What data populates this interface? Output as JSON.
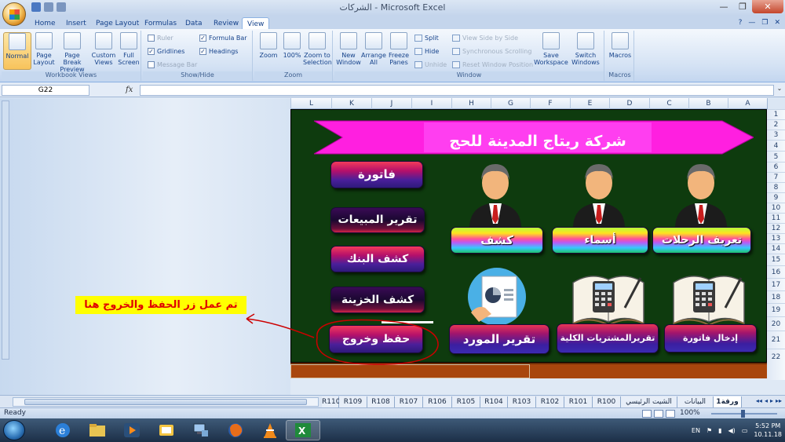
{
  "window": {
    "title": "الشركات - Microsoft Excel",
    "buttons": [
      "—",
      "❐",
      "✕"
    ]
  },
  "ribbon_tabs": [
    "Home",
    "Insert",
    "Page Layout",
    "Formulas",
    "Data",
    "Review",
    "View"
  ],
  "active_tab": "View",
  "ribbon": {
    "workbook_views": {
      "label": "Workbook Views",
      "buttons": [
        "Normal",
        "Page Layout",
        "Page Break Preview",
        "Custom Views",
        "Full Screen"
      ]
    },
    "show_hide": {
      "label": "Show/Hide",
      "ruler": "Ruler",
      "gridlines": "Gridlines",
      "message_bar": "Message Bar",
      "formula_bar": "Formula Bar",
      "headings": "Headings"
    },
    "zoom": {
      "label": "Zoom",
      "buttons": [
        "Zoom",
        "100%",
        "Zoom to Selection"
      ]
    },
    "window": {
      "label": "Window",
      "buttons": [
        "New Window",
        "Arrange All",
        "Freeze Panes"
      ],
      "split": "Split",
      "hide": "Hide",
      "unhide": "Unhide",
      "side_by_side": "View Side by Side",
      "sync_scroll": "Synchronous Scrolling",
      "reset_pos": "Reset Window Position",
      "save_workspace": "Save Workspace",
      "switch_windows": "Switch Windows"
    },
    "macros": {
      "label": "Macros",
      "button": "Macros"
    }
  },
  "formula_bar": {
    "name_box": "G22",
    "fx": "fx"
  },
  "columns": [
    "L",
    "K",
    "J",
    "I",
    "H",
    "G",
    "F",
    "E",
    "D",
    "C",
    "B",
    "A"
  ],
  "rows": [
    "1",
    "2",
    "3",
    "4",
    "5",
    "6",
    "7",
    "8",
    "9",
    "10",
    "11",
    "12",
    "13",
    "14",
    "15",
    "16",
    "17",
    "18",
    "19",
    "20",
    "21",
    "22"
  ],
  "sheet": {
    "banner": "شركة ريتاج المدينة للحج",
    "buttons": {
      "invoice": "فاتورة",
      "sales_report": "تقرير المبيعات",
      "bank_statement": "كشف البنك",
      "treasury_statement": "كشف الخزينة",
      "save_exit": "حفظ وخروج",
      "statement": "كشف",
      "names": "أسماء",
      "trips_def": "تعريف الرحلات",
      "supplier_report": "تقرير المورد",
      "total_purchases_report": "تقريرالمشتريات الكلية",
      "enter_invoice": "إدخال فاتورة"
    }
  },
  "annotation": "تم عمل زر الحفظ والخروج هنا",
  "sheet_tabs": [
    "ورقة1",
    "البيانات",
    "الشيت الرئيسي",
    "R100",
    "R101",
    "R102",
    "R103",
    "R104",
    "R105",
    "R106",
    "R107",
    "R108",
    "R109",
    "R110"
  ],
  "status": {
    "ready": "Ready",
    "zoom": "100%"
  },
  "taskbar": {
    "language": "EN",
    "time": "5:52 PM",
    "date": "10.11.18"
  },
  "colors": {
    "sheet_bg": "#0e3b0e",
    "banner": "#ff1fe0",
    "annotation_bg": "#ffff00",
    "annotation_text": "#e00000",
    "circle": "#cc0000"
  }
}
